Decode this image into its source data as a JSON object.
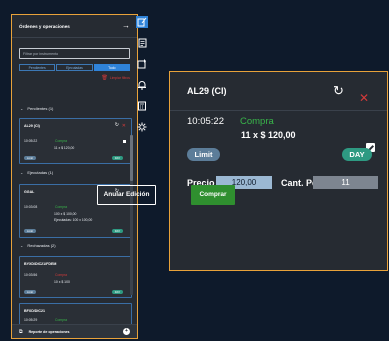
{
  "panel": {
    "title": "Órdenes y operaciones",
    "filter_placeholder": "Filtrar por instrumento",
    "tabs": [
      "Pendientes",
      "Ejecutadas",
      "Todo"
    ],
    "clear_filters": "Limpiar filtros",
    "sections": {
      "pending": "Pendientes (1)",
      "executed": "Ejecutadas (1)",
      "rejected": "Rechazadas (2)"
    },
    "cards": [
      {
        "title": "AL29 (CI)",
        "time": "10:05:22",
        "side": "Compra",
        "qty": "11 x $ 120,00",
        "limit": "Limit",
        "day": "DAY"
      },
      {
        "title": "GGAL",
        "time": "10:03:08",
        "side": "Compra",
        "qty": "100 x $ 100,00",
        "extra": "Ejecutadas: 100 x 100,00",
        "limit": "Limit",
        "day": "DAY"
      },
      {
        "title": "BYXD/DIC21/FDEM",
        "time": "10:03:56",
        "side": "Compra",
        "qty": "10 x $ 100",
        "limit": "Limit",
        "day": "DAY"
      },
      {
        "title": "BFXD/DIC21",
        "time": "10:05:29",
        "side": "Compra",
        "qty": "1 x $ 100"
      }
    ],
    "footer_label": "Reporte de operaciones"
  },
  "detail": {
    "title": "AL29 (CI)",
    "time": "10:05:22",
    "side": "Compra",
    "qty": "11 x $ 120,00",
    "limit_badge": "Limit",
    "day_badge": "DAY",
    "price_label": "Precio",
    "price_value": "120,00",
    "cant_label": "Cant. Pend.",
    "cant_value": "11",
    "cancel_button": "Anular Edición",
    "buy_button": "Comprar"
  },
  "colors": {
    "accent_border": "#e8a23a",
    "buy_green": "#39b54a",
    "close_red": "#d23a3a",
    "active_blue": "#2f83d9"
  },
  "icons": [
    "edit-panel-icon",
    "document-icon",
    "add-list-icon",
    "bell-icon",
    "calculator-icon",
    "gear-icon"
  ]
}
